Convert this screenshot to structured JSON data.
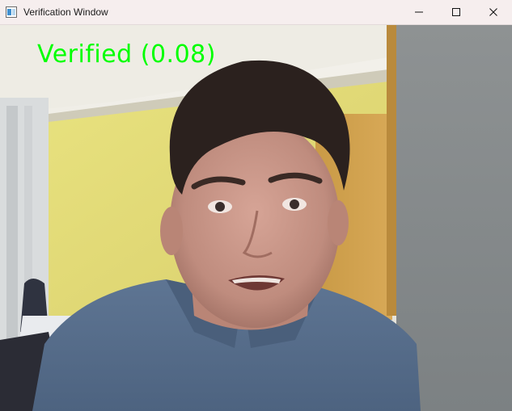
{
  "window": {
    "title": "Verification Window",
    "controls": {
      "minimize": "minimize-icon",
      "maximize": "maximize-icon",
      "close": "close-icon"
    }
  },
  "overlay": {
    "status_text": "Verified (0.08)",
    "color": "#00ff00"
  },
  "colors": {
    "titlebar_bg": "#f6eeee",
    "overlay_text": "#00ff00"
  }
}
